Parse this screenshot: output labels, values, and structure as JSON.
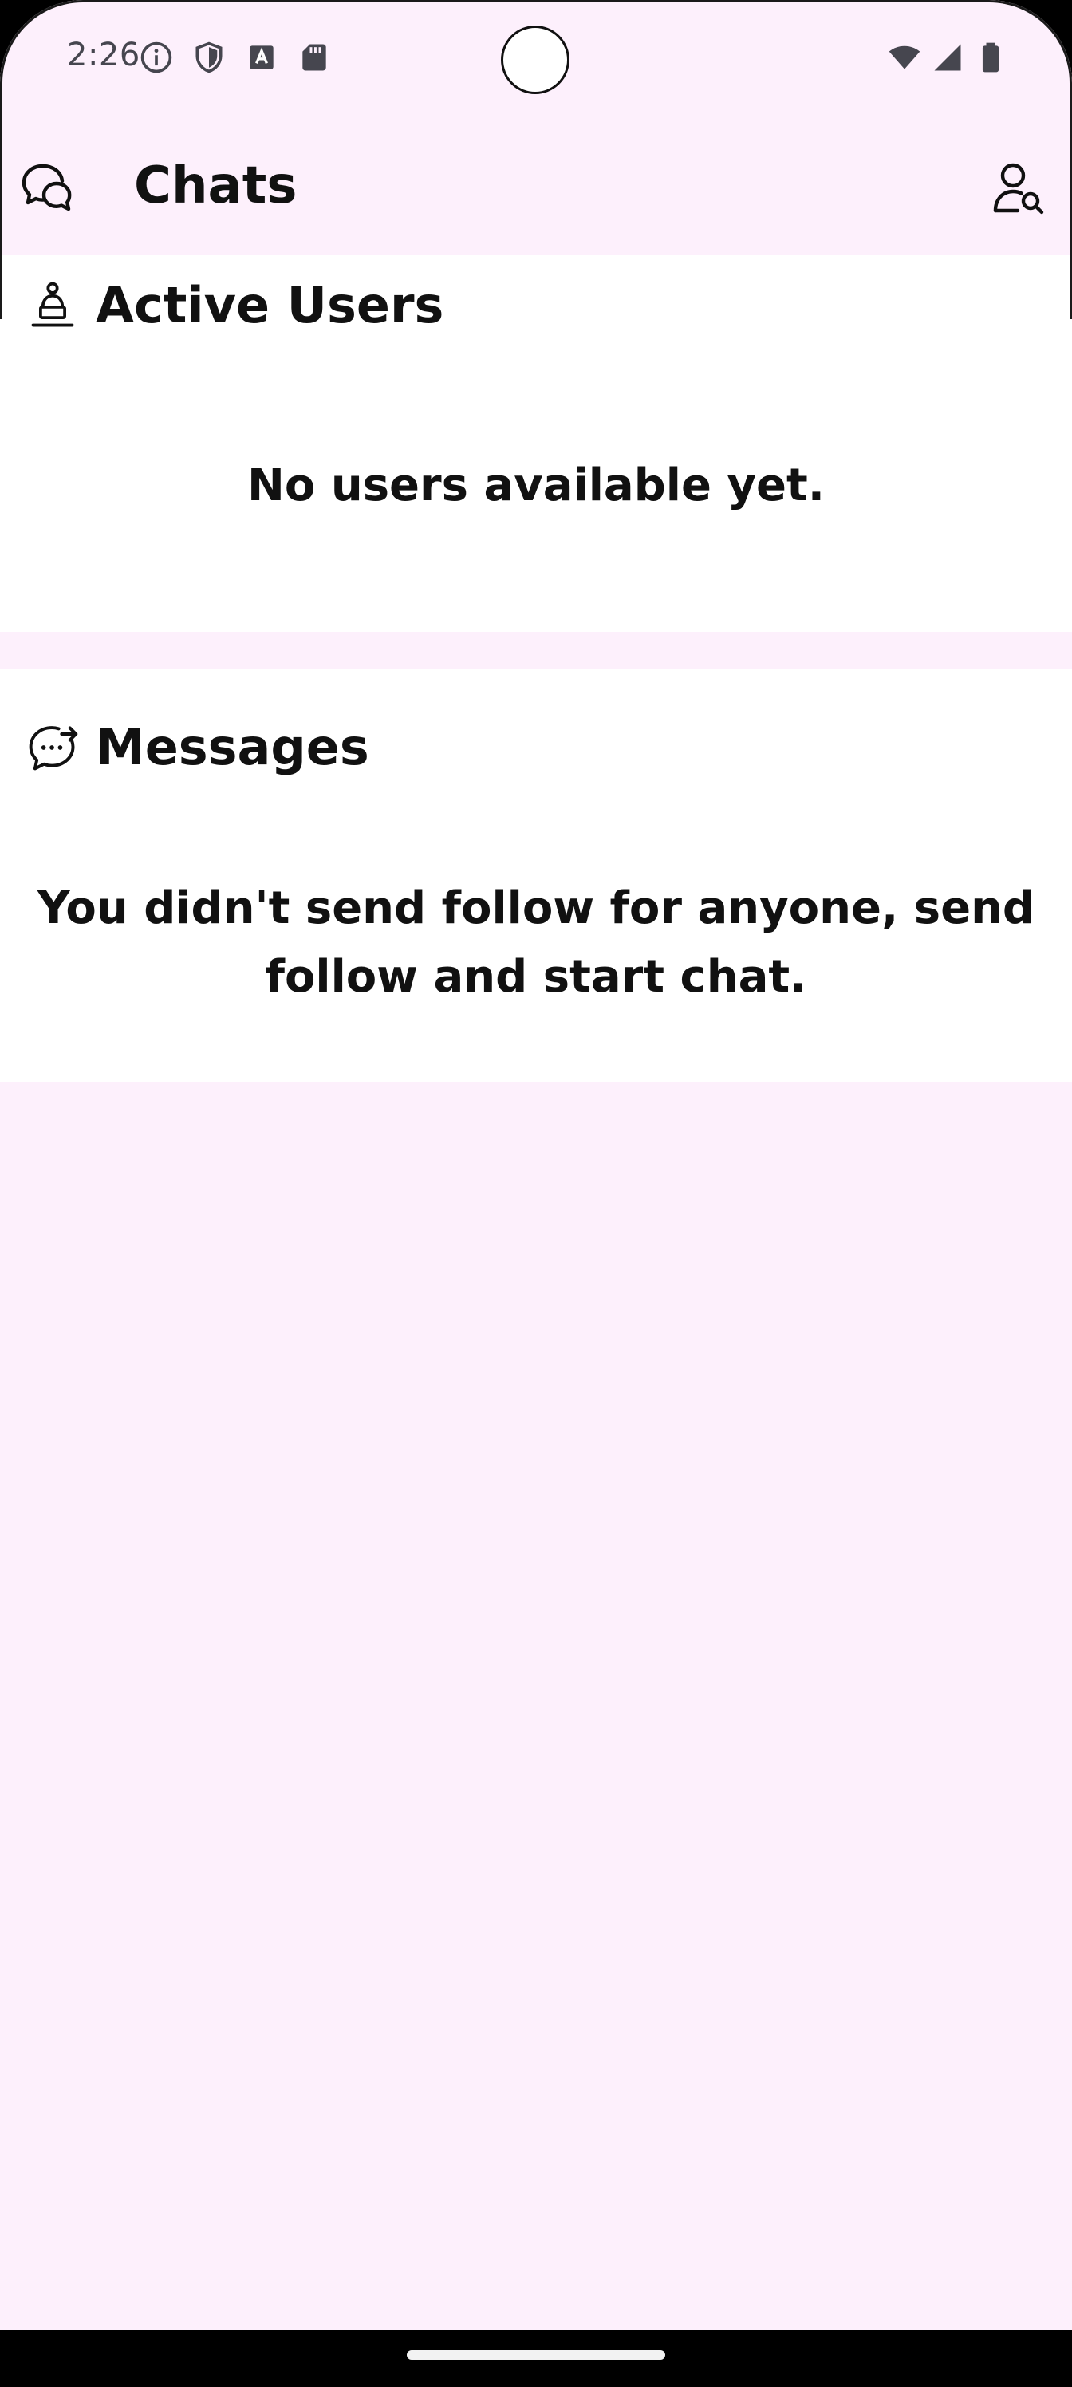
{
  "status_bar": {
    "time": "2:26",
    "left_icons": [
      "info-icon",
      "shield-icon",
      "font-icon",
      "sd-card-icon"
    ],
    "right_icons": [
      "wifi-icon",
      "cell-signal-icon",
      "battery-icon"
    ]
  },
  "app_bar": {
    "title": "Chats",
    "left_icon": "chat-bubbles-icon",
    "right_icon": "user-search-icon"
  },
  "active_users": {
    "title": "Active Users",
    "icon": "user-at-desk-icon",
    "empty_message": "No users available yet."
  },
  "messages": {
    "title": "Messages",
    "icon": "chat-forward-icon",
    "empty_message": "You didn't send follow for anyone, send follow and start chat."
  },
  "colors": {
    "background": "#fdf0fc",
    "card": "#ffffff",
    "text": "#111111",
    "status_text": "#46464f"
  }
}
